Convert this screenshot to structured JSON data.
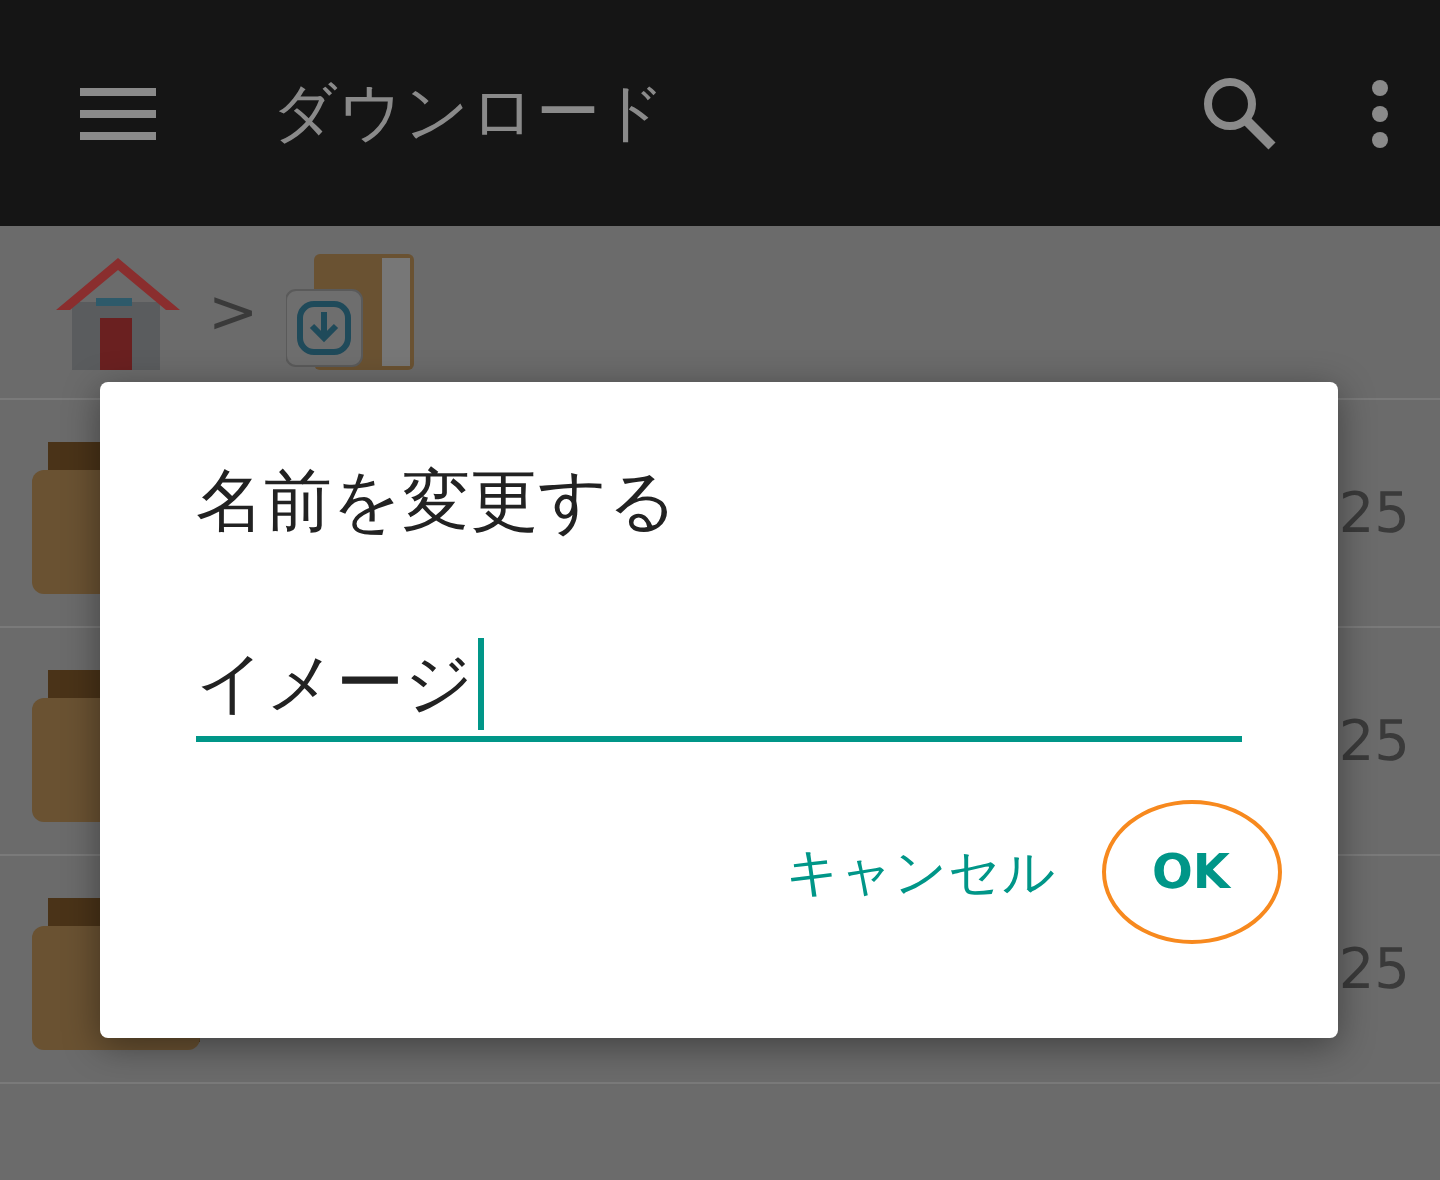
{
  "app_bar": {
    "title": "ダウンロード"
  },
  "breadcrumb": {
    "separator": ">"
  },
  "rows": [
    {
      "trailing": "25"
    },
    {
      "trailing": "25"
    },
    {
      "trailing": "25"
    }
  ],
  "dialog": {
    "title": "名前を変更する",
    "field": {
      "value": "イメージ",
      "focused": true
    },
    "buttons": [
      {
        "label": "キャンセル",
        "highlighted": false
      },
      {
        "label": "OK",
        "highlighted": true
      }
    ]
  }
}
